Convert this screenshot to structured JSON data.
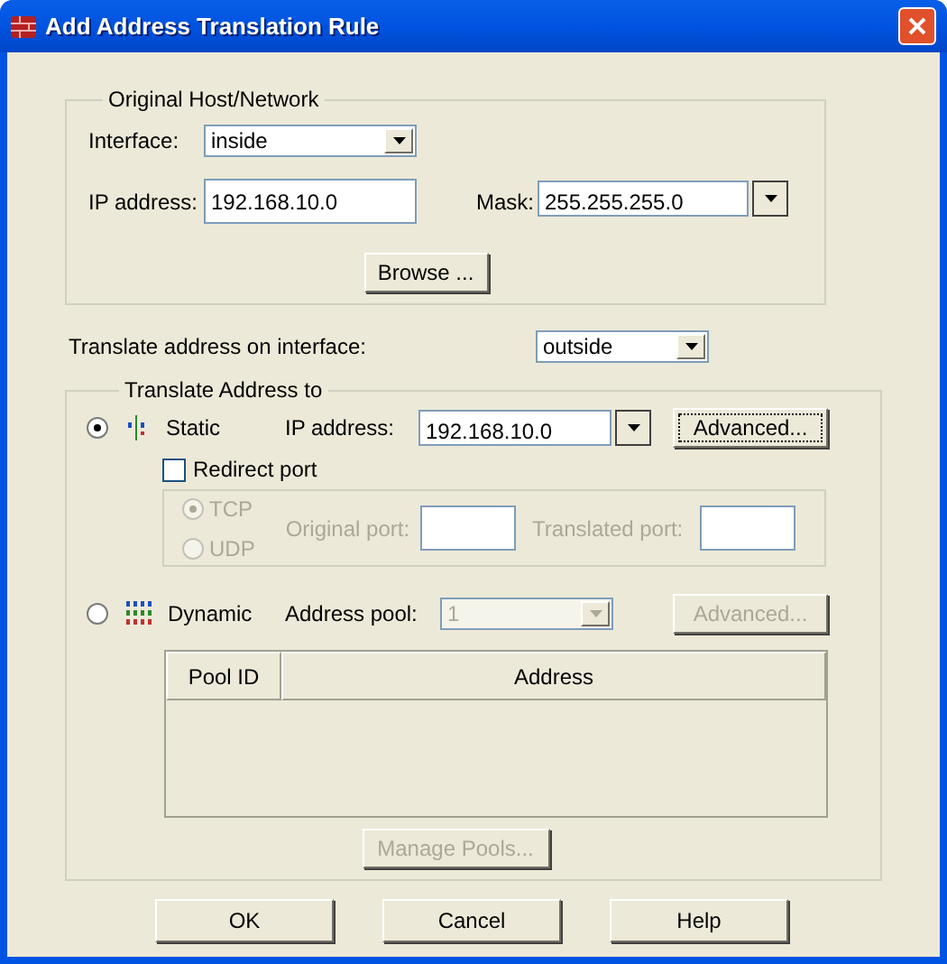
{
  "window": {
    "title": "Add Address Translation Rule"
  },
  "original": {
    "title": "Original Host/Network",
    "interface": {
      "label": "Interface:",
      "value": "inside"
    },
    "ip": {
      "label": "IP address:",
      "value": "192.168.10.0"
    },
    "mask": {
      "label": "Mask:",
      "value": "255.255.255.0"
    },
    "browse": "Browse ..."
  },
  "translate_interface": {
    "label": "Translate address on interface:",
    "value": "outside"
  },
  "translate_to": {
    "title": "Translate Address to",
    "static": {
      "label": "Static",
      "selected": true,
      "ip_label": "IP address:",
      "ip_value": "192.168.10.0",
      "advanced": {
        "label": "Advanced...",
        "disabled": false
      }
    },
    "redirect": {
      "label": "Redirect port",
      "checked": false,
      "disabled": true,
      "protocols": [
        {
          "label": "TCP",
          "selected": true
        },
        {
          "label": "UDP",
          "selected": false
        }
      ],
      "original_port": {
        "label": "Original port:"
      },
      "translated_port": {
        "label": "Translated port:"
      }
    },
    "dynamic": {
      "label": "Dynamic",
      "selected": false,
      "disabled": true,
      "pool_label": "Address pool:",
      "pool_value": "1",
      "advanced": {
        "label": "Advanced...",
        "disabled": true
      }
    },
    "table": {
      "columns": [
        "Pool ID",
        "Address"
      ]
    },
    "manage_pools": {
      "label": "Manage Pools...",
      "disabled": true
    }
  },
  "buttons": [
    "OK",
    "Cancel",
    "Help"
  ]
}
